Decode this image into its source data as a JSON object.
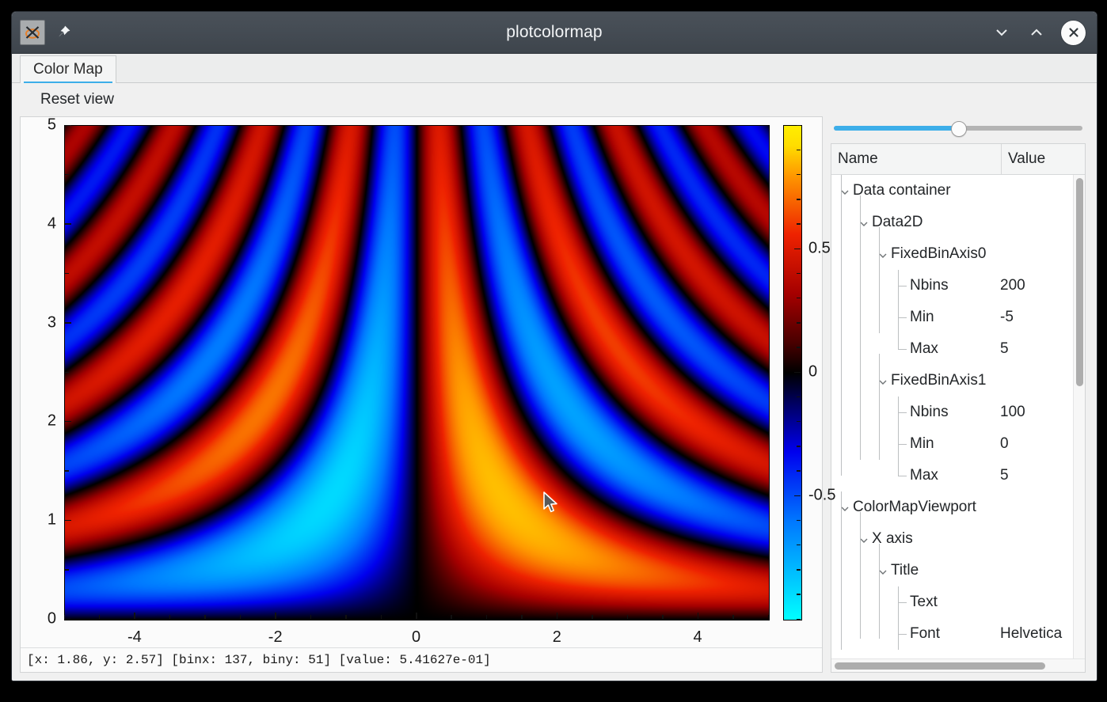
{
  "window": {
    "title": "plotcolormap",
    "app_icon": "app-logo-icon",
    "pin_icon": "pin-icon",
    "minimize_icon": "chevron-down-icon",
    "maximize_icon": "chevron-up-icon",
    "close_icon": "close-icon"
  },
  "tabs": [
    {
      "label": "Color Map",
      "active": true
    }
  ],
  "toolbar": {
    "reset_view_label": "Reset view"
  },
  "statusbar": {
    "text": "[x: 1.86, y: 2.57] [binx: 137, biny: 51] [value: 5.41627e-01]"
  },
  "slider": {
    "value_percent": 50
  },
  "tree": {
    "columns": [
      "Name",
      "Value"
    ],
    "rows": [
      {
        "depth": 0,
        "expander": "expanded",
        "name": "Data container",
        "value": ""
      },
      {
        "depth": 1,
        "expander": "expanded",
        "name": "Data2D",
        "value": ""
      },
      {
        "depth": 2,
        "expander": "expanded",
        "name": "FixedBinAxis0",
        "value": ""
      },
      {
        "depth": 3,
        "expander": "leaf",
        "name": "Nbins",
        "value": "200"
      },
      {
        "depth": 3,
        "expander": "leaf",
        "name": "Min",
        "value": "-5"
      },
      {
        "depth": 3,
        "expander": "leaf-last",
        "name": "Max",
        "value": "5"
      },
      {
        "depth": 2,
        "expander": "expanded",
        "name": "FixedBinAxis1",
        "value": ""
      },
      {
        "depth": 3,
        "expander": "leaf",
        "name": "Nbins",
        "value": "100"
      },
      {
        "depth": 3,
        "expander": "leaf",
        "name": "Min",
        "value": "0"
      },
      {
        "depth": 3,
        "expander": "leaf-last",
        "name": "Max",
        "value": "5"
      },
      {
        "depth": 0,
        "expander": "expanded",
        "name": "ColorMapViewport",
        "value": ""
      },
      {
        "depth": 1,
        "expander": "expanded",
        "name": "X axis",
        "value": ""
      },
      {
        "depth": 2,
        "expander": "expanded",
        "name": "Title",
        "value": ""
      },
      {
        "depth": 3,
        "expander": "leaf",
        "name": "Text",
        "value": ""
      },
      {
        "depth": 3,
        "expander": "leaf",
        "name": "Font",
        "value": "Helvetica"
      }
    ]
  },
  "chart_data": {
    "type": "heatmap",
    "title": "",
    "xlabel": "",
    "ylabel": "",
    "function": "amplitude * sin(x*y) style interference pattern, antisymmetric about x=0",
    "x_range": [
      -5,
      5
    ],
    "y_range": [
      0,
      5
    ],
    "nbins_x": 200,
    "nbins_y": 100,
    "x_ticks": [
      -4,
      -2,
      0,
      2,
      4
    ],
    "x_tick_labels": [
      "-4",
      "-2",
      "0",
      "2",
      "4"
    ],
    "y_ticks": [
      0,
      1,
      2,
      3,
      4,
      5
    ],
    "y_tick_labels": [
      "0",
      "1",
      "2",
      "3",
      "4",
      "5"
    ],
    "minor_ticks_per_major": 2,
    "colorbar": {
      "ticks": [
        -0.5,
        0,
        0.5
      ],
      "tick_labels": [
        "-0.5",
        "0",
        "0.5"
      ],
      "zmin": -1.0,
      "zmax": 1.0,
      "colormap": "temperature",
      "stops": [
        {
          "pos": 0.0,
          "color": "#00ffff"
        },
        {
          "pos": 0.2,
          "color": "#0077ff"
        },
        {
          "pos": 0.34,
          "color": "#0000ee"
        },
        {
          "pos": 0.5,
          "color": "#000000"
        },
        {
          "pos": 0.66,
          "color": "#a50000"
        },
        {
          "pos": 0.78,
          "color": "#ee2200"
        },
        {
          "pos": 0.9,
          "color": "#ff9900"
        },
        {
          "pos": 1.0,
          "color": "#ffee00"
        }
      ]
    },
    "hover_readout": {
      "x": 1.86,
      "y": 2.57,
      "binx": 137,
      "biny": 51,
      "value": "5.41627e-01"
    }
  },
  "colors": {
    "titlebar": "#434a52",
    "accent": "#3daee9",
    "panel_bg": "#f0f0f0",
    "plot_bg": "#fbfbfb",
    "text": "#232629"
  }
}
